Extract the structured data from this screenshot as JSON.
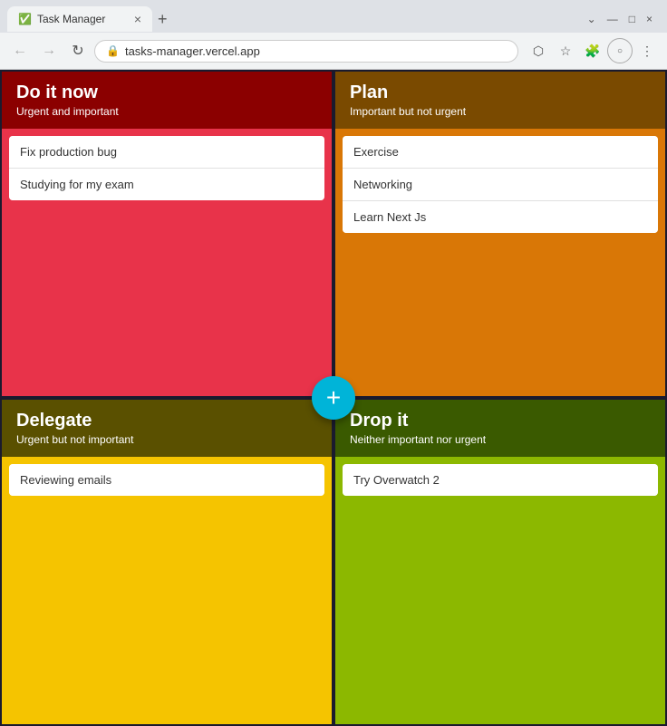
{
  "browser": {
    "tab_title": "Task Manager",
    "tab_close": "×",
    "tab_new": "+",
    "window_controls": {
      "minimize": "—",
      "maximize": "□",
      "close": "×",
      "chevron": "⌄"
    },
    "nav": {
      "back": "←",
      "forward": "→",
      "reload": "↻",
      "url": "tasks-manager.vercel.app",
      "lock": "🔒"
    },
    "nav_actions": {
      "share": "⬡",
      "star": "☆",
      "extension": "🧩",
      "profile_circle": "○",
      "menu": "⋮"
    }
  },
  "fab": {
    "label": "+"
  },
  "quadrants": {
    "do": {
      "title": "Do it now",
      "subtitle": "Urgent and important",
      "tasks": [
        {
          "text": "Fix production bug"
        },
        {
          "text": "Studying for my exam"
        }
      ]
    },
    "plan": {
      "title": "Plan",
      "subtitle": "Important but not urgent",
      "tasks": [
        {
          "text": "Exercise"
        },
        {
          "text": "Networking"
        },
        {
          "text": "Learn Next Js"
        }
      ]
    },
    "delegate": {
      "title": "Delegate",
      "subtitle": "Urgent but not important",
      "tasks": [
        {
          "text": "Reviewing emails"
        }
      ]
    },
    "drop": {
      "title": "Drop it",
      "subtitle": "Neither important nor urgent",
      "tasks": [
        {
          "text": "Try Overwatch 2"
        }
      ]
    }
  }
}
